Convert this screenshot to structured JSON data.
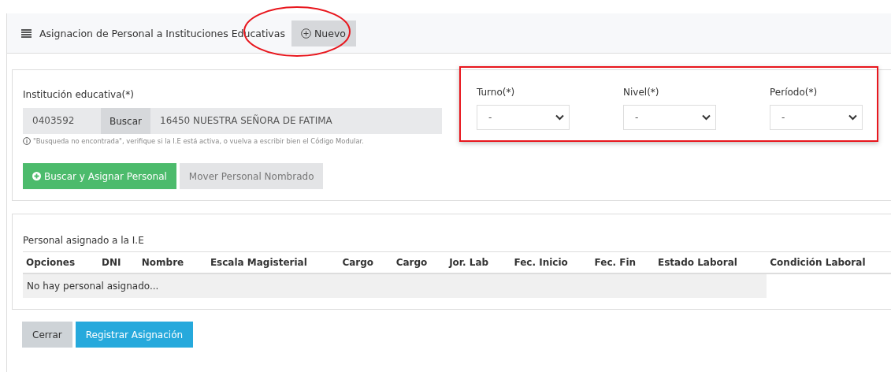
{
  "header": {
    "title": "Asignacion de Personal a Instituciones Educativas",
    "new_button": "Nuevo"
  },
  "institution": {
    "label": "Institución educativa(*)",
    "code": "0403592",
    "search_button": "Buscar",
    "name": "16450 NUESTRA SEÑORA DE FATIMA",
    "hint": "\"Busqueda no encontrada\", verifique si la I.E está activa, o vuelva a escribir bien el Código Modular."
  },
  "selects": [
    {
      "label": "Turno(*)",
      "value": "-"
    },
    {
      "label": "Nivel(*)",
      "value": "-"
    },
    {
      "label": "Período(*)",
      "value": "-"
    }
  ],
  "actions": [
    {
      "label": "Buscar y Asignar Personal",
      "kind": "primary"
    },
    {
      "label": "Mover Personal Nombrado",
      "kind": "disabled"
    }
  ],
  "table": {
    "title": "Personal asignado a la I.E",
    "columns": [
      "Opciones",
      "DNI",
      "Nombre",
      "Escala Magisterial",
      "Cargo",
      "Cargo",
      "Jor. Lab",
      "Fec. Inicio",
      "Fec. Fin",
      "Estado Laboral",
      "Condición Laboral"
    ],
    "empty": "No hay personal asignado..."
  },
  "footer_buttons": [
    {
      "label": "Cerrar",
      "kind": "secondary"
    },
    {
      "label": "Registrar Asignación",
      "kind": "info"
    }
  ]
}
